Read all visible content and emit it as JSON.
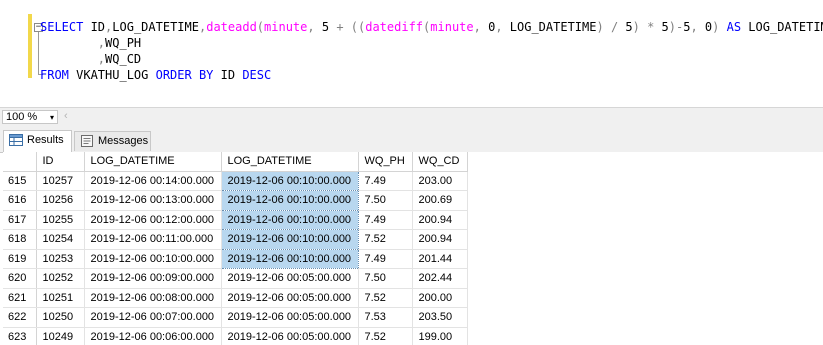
{
  "editor": {
    "lines": [
      {
        "tokens": [
          {
            "t": "SELECT",
            "c": "kw"
          },
          {
            "t": " ID",
            "c": ""
          },
          {
            "t": ",",
            "c": "op"
          },
          {
            "t": "LOG_DATETIME",
            "c": ""
          },
          {
            "t": ",",
            "c": "op"
          },
          {
            "t": "dateadd",
            "c": "fn"
          },
          {
            "t": "(",
            "c": "op"
          },
          {
            "t": "minute",
            "c": "fn"
          },
          {
            "t": ",",
            "c": "op"
          },
          {
            "t": " 5 ",
            "c": ""
          },
          {
            "t": "+",
            "c": "op"
          },
          {
            "t": " ",
            "c": ""
          },
          {
            "t": "((",
            "c": "op"
          },
          {
            "t": "datediff",
            "c": "fn"
          },
          {
            "t": "(",
            "c": "op"
          },
          {
            "t": "minute",
            "c": "fn"
          },
          {
            "t": ",",
            "c": "op"
          },
          {
            "t": " 0",
            "c": ""
          },
          {
            "t": ",",
            "c": "op"
          },
          {
            "t": " LOG_DATETIME",
            "c": ""
          },
          {
            "t": ")",
            "c": "op"
          },
          {
            "t": " ",
            "c": ""
          },
          {
            "t": "/",
            "c": "op"
          },
          {
            "t": " 5",
            "c": ""
          },
          {
            "t": ")",
            "c": "op"
          },
          {
            "t": " ",
            "c": ""
          },
          {
            "t": "*",
            "c": "op"
          },
          {
            "t": " 5",
            "c": ""
          },
          {
            "t": ")-",
            "c": "op"
          },
          {
            "t": "5",
            "c": ""
          },
          {
            "t": ",",
            "c": "op"
          },
          {
            "t": " 0",
            "c": ""
          },
          {
            "t": ")",
            "c": "op"
          },
          {
            "t": " ",
            "c": ""
          },
          {
            "t": "AS",
            "c": "kw"
          },
          {
            "t": " LOG_DATETIME",
            "c": ""
          }
        ]
      },
      {
        "tokens": [
          {
            "t": "        ",
            "c": ""
          },
          {
            "t": ",",
            "c": "op"
          },
          {
            "t": "WQ_PH",
            "c": ""
          }
        ]
      },
      {
        "tokens": [
          {
            "t": "        ",
            "c": ""
          },
          {
            "t": ",",
            "c": "op"
          },
          {
            "t": "WQ_CD",
            "c": ""
          }
        ]
      },
      {
        "tokens": [
          {
            "t": "FROM",
            "c": "kw"
          },
          {
            "t": " VKATHU_LOG ",
            "c": ""
          },
          {
            "t": "ORDER BY",
            "c": "kw"
          },
          {
            "t": " ID ",
            "c": ""
          },
          {
            "t": "DESC",
            "c": "kw"
          }
        ]
      }
    ]
  },
  "status": {
    "zoom": "100 %",
    "zoom_arrow": "▾",
    "scroll_left": "‹"
  },
  "tabs": {
    "results": "Results",
    "messages": "Messages"
  },
  "grid": {
    "columns": [
      "",
      "ID",
      "LOG_DATETIME",
      "LOG_DATETIME",
      "WQ_PH",
      "WQ_CD"
    ],
    "rows": [
      [
        "615",
        "10257",
        "2019-12-06 00:14:00.000",
        "2019-12-06 00:10:00.000",
        "7.49",
        "203.00"
      ],
      [
        "616",
        "10256",
        "2019-12-06 00:13:00.000",
        "2019-12-06 00:10:00.000",
        "7.50",
        "200.69"
      ],
      [
        "617",
        "10255",
        "2019-12-06 00:12:00.000",
        "2019-12-06 00:10:00.000",
        "7.49",
        "200.94"
      ],
      [
        "618",
        "10254",
        "2019-12-06 00:11:00.000",
        "2019-12-06 00:10:00.000",
        "7.52",
        "200.94"
      ],
      [
        "619",
        "10253",
        "2019-12-06 00:10:00.000",
        "2019-12-06 00:10:00.000",
        "7.49",
        "201.44"
      ],
      [
        "620",
        "10252",
        "2019-12-06 00:09:00.000",
        "2019-12-06 00:05:00.000",
        "7.50",
        "202.44"
      ],
      [
        "621",
        "10251",
        "2019-12-06 00:08:00.000",
        "2019-12-06 00:05:00.000",
        "7.52",
        "200.00"
      ],
      [
        "622",
        "10250",
        "2019-12-06 00:07:00.000",
        "2019-12-06 00:05:00.000",
        "7.53",
        "203.50"
      ],
      [
        "623",
        "10249",
        "2019-12-06 00:06:00.000",
        "2019-12-06 00:05:00.000",
        "7.52",
        "199.00"
      ]
    ],
    "selected_column": 3,
    "selected_rows": [
      0,
      1,
      2,
      3,
      4
    ]
  },
  "colors": {
    "keyword": "#0000ff",
    "function": "#ff00ff",
    "operator": "#808080",
    "selection": "#b8d7ef"
  }
}
